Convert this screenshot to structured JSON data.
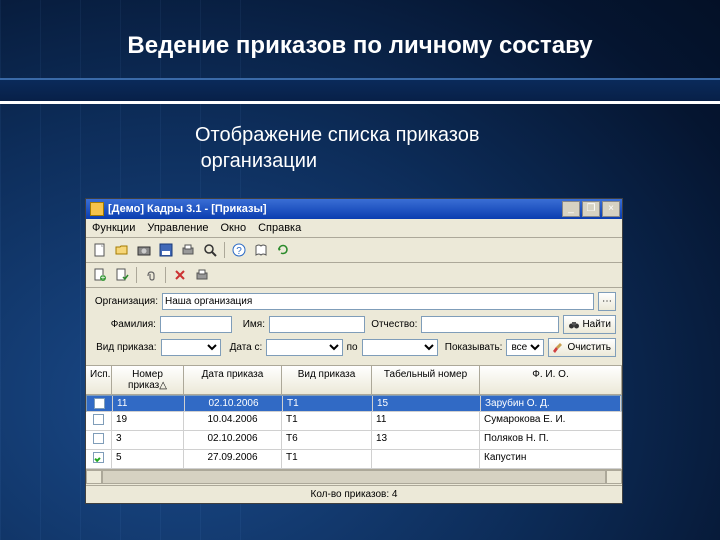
{
  "slide": {
    "title": "Ведение приказов по личному составу",
    "subtitle_l1": "Отображение списка приказов",
    "subtitle_l2": "организации"
  },
  "win": {
    "title": "[Демо] Кадры 3.1 - [Приказы]",
    "btn_min": "_",
    "btn_max": "❐",
    "btn_close": "×"
  },
  "menu": {
    "m1": "Функции",
    "m2": "Управление",
    "m3": "Окно",
    "m4": "Справка"
  },
  "filters": {
    "org_label": "Организация:",
    "org_value": "Наша организация",
    "lastname_label": "Фамилия:",
    "firstname_label": "Имя:",
    "middlename_label": "Отчество:",
    "find_label": "Найти",
    "type_label": "Вид приказа:",
    "datefrom_label": "Дата с:",
    "dateword_label": "по",
    "show_label": "Показывать:",
    "show_value": "все",
    "clear_label": "Очистить"
  },
  "grid": {
    "h0": "Исп.",
    "h1": "Номер приказ△",
    "h2": "Дата приказа",
    "h3": "Вид приказа",
    "h4": "Табельный номер",
    "h5": "Ф. И. О.",
    "rows": [
      {
        "chk": false,
        "no": "11",
        "date": "02.10.2006",
        "type": "Т1",
        "tab": "15",
        "fio": "Зарубин О. Д.",
        "sel": true
      },
      {
        "chk": false,
        "no": "19",
        "date": "10.04.2006",
        "type": "Т1",
        "tab": "11",
        "fio": "Сумарокова Е. И.",
        "sel": false
      },
      {
        "chk": false,
        "no": "3",
        "date": "02.10.2006",
        "type": "Т6",
        "tab": "13",
        "fio": "Поляков Н. П.",
        "sel": false
      },
      {
        "chk": true,
        "no": "5",
        "date": "27.09.2006",
        "type": "Т1",
        "tab": "",
        "fio": "Капустин",
        "sel": false
      }
    ],
    "status": "Кол-во приказов: 4"
  }
}
